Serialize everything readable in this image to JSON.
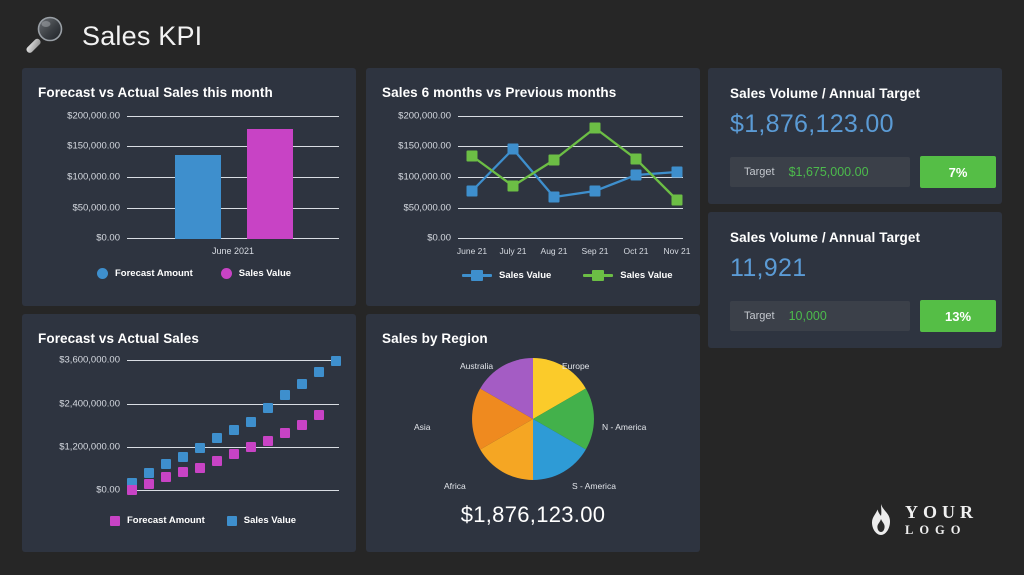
{
  "header": {
    "title": "Sales KPI",
    "icon": "magnifier-icon"
  },
  "logo": {
    "line1": "YOUR",
    "line2": "LOGO",
    "icon": "flame-icon"
  },
  "colors": {
    "page_bg": "#262626",
    "panel_bg": "#2e3440",
    "blue": "#3e8fcd",
    "magenta": "#c843c5",
    "green": "#6cbe45",
    "kpi_value": "#5b9bd5",
    "target_green": "#4cbb4c",
    "badge_green": "#55be46"
  },
  "panels": {
    "bar": {
      "title": "Forecast vs Actual Sales this month"
    },
    "line": {
      "title": "Sales 6 months vs Previous months"
    },
    "scatter": {
      "title": "Forecast vs Actual Sales"
    },
    "pie": {
      "title": "Sales by Region"
    },
    "kpi1": {
      "title": "Sales Volume / Annual Target"
    },
    "kpi2": {
      "title": "Sales Volume / Annual Target"
    }
  },
  "kpi_cards": [
    {
      "title": "Sales Volume / Annual Target",
      "value": "$1,876,123.00",
      "target_label": "Target",
      "target_value": "$1,675,000.00",
      "badge": "7%"
    },
    {
      "title": "Sales Volume / Annual Target",
      "value": "11,921",
      "target_label": "Target",
      "target_value": "10,000",
      "badge": "13%"
    }
  ],
  "pie_total": "$1,876,123.00",
  "chart_data": [
    {
      "id": "bar",
      "type": "bar",
      "title": "Forecast vs Actual Sales this month",
      "categories": [
        "June 2021"
      ],
      "xlabel": "",
      "ylabel": "",
      "ylim": [
        0,
        200000
      ],
      "yticks": [
        0,
        50000,
        100000,
        150000,
        200000
      ],
      "ytick_labels": [
        "$0.00",
        "$50,000.00",
        "$100,000.00",
        "$150,000.00",
        "$200,000.00"
      ],
      "xtick_labels": [
        "June 2021"
      ],
      "grid": true,
      "legend_position": "bottom",
      "series": [
        {
          "name": "Forecast Amount",
          "color": "#3e8fcd",
          "values": [
            137000
          ]
        },
        {
          "name": "Sales Value",
          "color": "#c843c5",
          "values": [
            179000
          ]
        }
      ]
    },
    {
      "id": "line",
      "type": "line",
      "title": "Sales 6 months vs Previous months",
      "categories": [
        "June 21",
        "July 21",
        "Aug 21",
        "Sep 21",
        "Oct 21",
        "Nov 21"
      ],
      "xlabel": "",
      "ylabel": "",
      "ylim": [
        0,
        200000
      ],
      "yticks": [
        0,
        50000,
        100000,
        150000,
        200000
      ],
      "ytick_labels": [
        "$0.00",
        "$50,000.00",
        "$100,000.00",
        "$150,000.00",
        "$200,000.00"
      ],
      "grid": true,
      "legend_position": "bottom",
      "series": [
        {
          "name": "Sales Value",
          "color": "#3e8fcd",
          "values": [
            78000,
            145000,
            67000,
            78000,
            105000,
            110000
          ]
        },
        {
          "name": "Sales Value",
          "color": "#6cbe45",
          "values": [
            135000,
            85000,
            128000,
            180000,
            130000,
            63000
          ]
        }
      ]
    },
    {
      "id": "scatter",
      "type": "scatter",
      "title": "Forecast vs Actual Sales",
      "xlabel": "",
      "ylabel": "",
      "ylim": [
        0,
        3600000
      ],
      "yticks": [
        0,
        1200000,
        2400000,
        3600000
      ],
      "ytick_labels": [
        "$0.00",
        "$1,200,000.00",
        "$2,400,000.00",
        "$3,600,000.00"
      ],
      "grid": true,
      "legend_position": "bottom",
      "series": [
        {
          "name": "Forecast Amount",
          "color": "#c843c5",
          "x": [
            1,
            2,
            3,
            4,
            5,
            6,
            7,
            8,
            9,
            10,
            11,
            12
          ],
          "values": [
            60000,
            220000,
            420000,
            560000,
            640000,
            830000,
            1010000,
            1180000,
            1340000,
            1560000,
            1790000,
            2070000
          ]
        },
        {
          "name": "Sales Value",
          "color": "#3e8fcd",
          "x": [
            1,
            2,
            3,
            4,
            5,
            6,
            7,
            8,
            9,
            10,
            11,
            12
          ],
          "values": [
            200000,
            460000,
            700000,
            880000,
            1140000,
            1420000,
            1650000,
            1880000,
            2290000,
            2630000,
            2930000,
            3250000,
            3580000
          ]
        }
      ]
    },
    {
      "id": "pie",
      "type": "pie",
      "title": "Sales by Region",
      "total_label": "$1,876,123.00",
      "labels": [
        "Europe",
        "N - America",
        "S - America",
        "Africa",
        "Asia",
        "Australia"
      ],
      "values": [
        16.67,
        16.67,
        16.67,
        16.67,
        16.67,
        16.67
      ],
      "colors": [
        "#fbcb2a",
        "#43b14b",
        "#2e9bd6",
        "#f5a623",
        "#ef8a1f",
        "#a45cc4"
      ],
      "legend_position": "around"
    }
  ]
}
